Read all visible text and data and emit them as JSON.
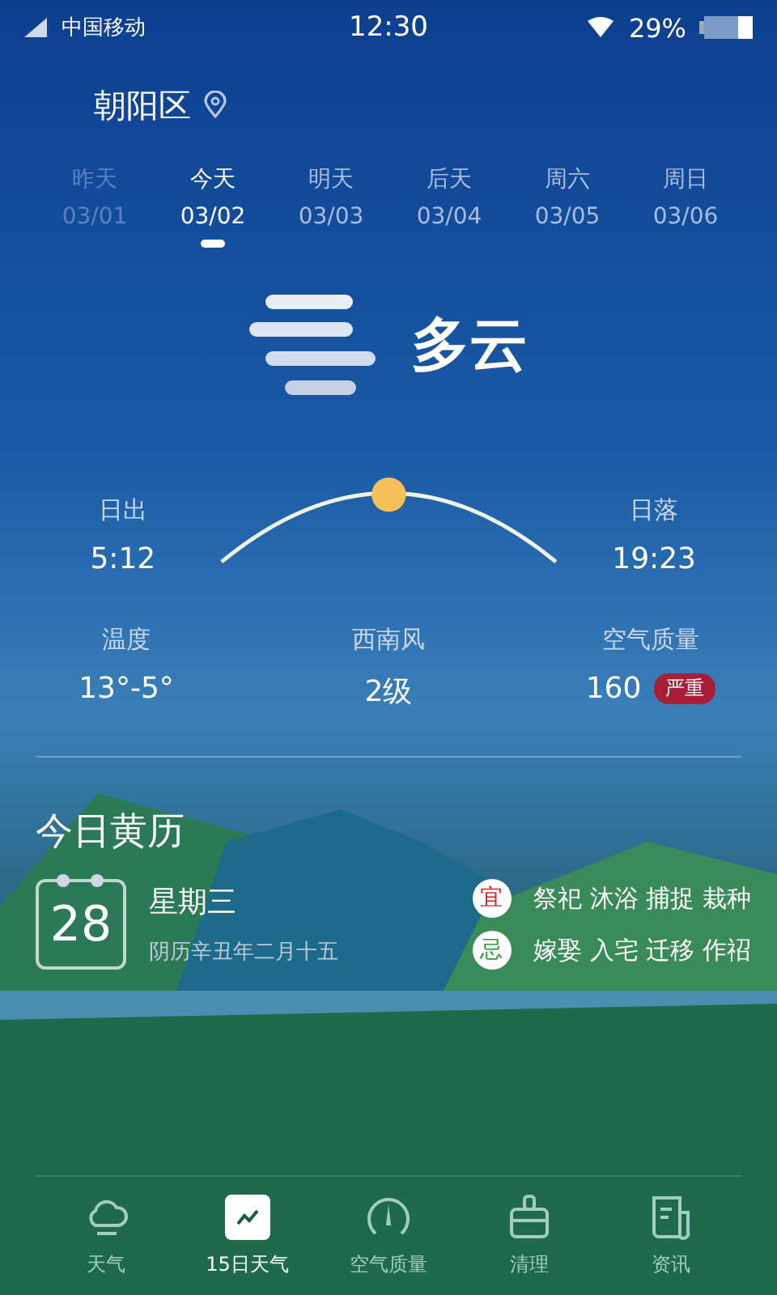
{
  "status_bar": {
    "carrier": "中国移动",
    "time": "12:30",
    "battery": "29%"
  },
  "location": {
    "name": "朝阳区"
  },
  "days": [
    {
      "label": "昨天",
      "date": "03/01",
      "past": true,
      "selected": false
    },
    {
      "label": "今天",
      "date": "03/02",
      "past": false,
      "selected": true
    },
    {
      "label": "明天",
      "date": "03/03",
      "past": false,
      "selected": false
    },
    {
      "label": "后天",
      "date": "03/04",
      "past": false,
      "selected": false
    },
    {
      "label": "周六",
      "date": "03/05",
      "past": false,
      "selected": false
    },
    {
      "label": "周日",
      "date": "03/06",
      "past": false,
      "selected": false
    }
  ],
  "condition": "多云",
  "sun": {
    "sunrise_label": "日出",
    "sunrise": "5:12",
    "sunset_label": "日落",
    "sunset": "19:23"
  },
  "stats": [
    {
      "label": "温度",
      "value": "13°-5°"
    },
    {
      "label": "西南风",
      "value": "2级"
    },
    {
      "label": "空气质量",
      "value": "160",
      "badge": "严重"
    }
  ],
  "almanac": {
    "title": "今日黄历",
    "day": "28",
    "weekday": "星期三",
    "lunar": "阴历辛丑年二月十五",
    "rows": [
      {
        "mark": "宜",
        "color": "#d0262b",
        "items": "祭祀 沐浴 捕捉 栽种"
      },
      {
        "mark": "忌",
        "color": "#2a9a3c",
        "items": "嫁娶 入宅 迁移 作祒"
      }
    ]
  },
  "nav": [
    {
      "label": "天气",
      "selected": false
    },
    {
      "label": "15日天气",
      "selected": true
    },
    {
      "label": "空气质量",
      "selected": false
    },
    {
      "label": "清理",
      "selected": false
    },
    {
      "label": "资讯",
      "selected": false
    }
  ]
}
